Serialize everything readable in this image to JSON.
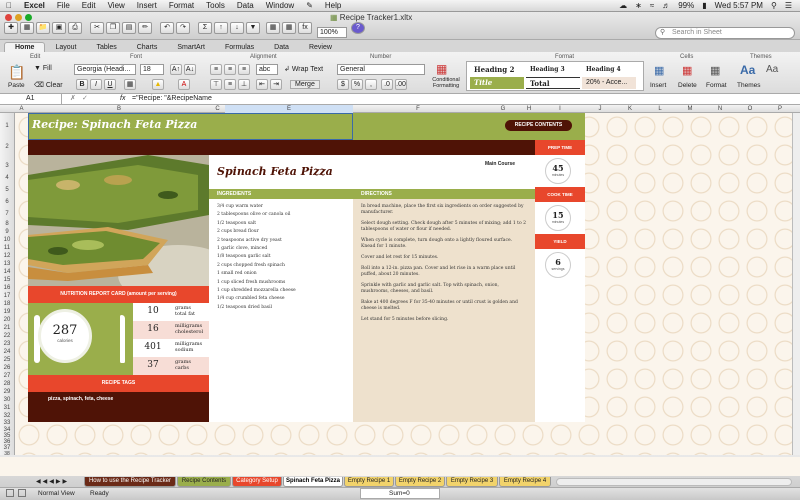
{
  "menubar": {
    "apple": "",
    "app": "Excel",
    "items": [
      "File",
      "Edit",
      "View",
      "Insert",
      "Format",
      "Tools",
      "Data",
      "Window",
      "Help"
    ],
    "battery": "99%",
    "clock": "Wed 5:57 PM"
  },
  "window": {
    "title": "Recipe Tracker1.xltx"
  },
  "toolbar": {
    "zoom": "100%",
    "search_placeholder": "Search in Sheet"
  },
  "ribbon_tabs": [
    "Home",
    "Layout",
    "Tables",
    "Charts",
    "SmartArt",
    "Formulas",
    "Data",
    "Review"
  ],
  "ribbon": {
    "groups": {
      "edit": "Edit",
      "font": "Font",
      "alignment": "Alignment",
      "number": "Number",
      "format": "Format",
      "cells": "Cells",
      "themes": "Themes"
    },
    "paste_label": "Paste",
    "fill_label": "Fill",
    "clear_label": "Clear",
    "font_name": "Georgia (Headi...",
    "font_size": "18",
    "wrap_text": "Wrap Text",
    "merge": "Merge",
    "number_format": "General",
    "abc": "abc",
    "conditional_formatting": "Conditional Formatting",
    "styles": [
      {
        "label": "Heading 2",
        "color": "#7d8f37"
      },
      {
        "label": "Heading 3",
        "color": "#4f1306"
      },
      {
        "label": "Heading 4",
        "color": "#4f1306"
      },
      {
        "label": "Title",
        "color": "#ffffff",
        "bg": "#9aae4b"
      },
      {
        "label": "Total",
        "color": "#222"
      },
      {
        "label": "20% - Acce...",
        "color": "#222"
      }
    ],
    "cells_buttons": [
      "Insert",
      "Delete",
      "Format"
    ],
    "themes_label": "Themes"
  },
  "formula_bar": {
    "cell_ref": "A1",
    "fx": "fx",
    "formula": "=\"Recipe: \"&RecipeName"
  },
  "columns": [
    "A",
    "B",
    "C",
    "D",
    "E",
    "F",
    "G",
    "H",
    "I",
    "J",
    "K",
    "L",
    "M",
    "N",
    "O",
    "P"
  ],
  "rows": [
    "1",
    "2",
    "3",
    "4",
    "5",
    "6",
    "7",
    "8",
    "9",
    "10",
    "11",
    "12",
    "13",
    "14",
    "15",
    "16",
    "17",
    "18",
    "19",
    "20",
    "21",
    "22",
    "23",
    "24",
    "25",
    "26",
    "27",
    "28",
    "29",
    "30",
    "31",
    "32",
    "33",
    "34",
    "35",
    "36",
    "37",
    "38",
    "39",
    "40",
    "41",
    "42",
    "43",
    "44",
    "45"
  ],
  "sheet": {
    "title": "Recipe: Spinach Feta Pizza",
    "recipe_contents_button": "RECIPE CONTENTS",
    "recipe_name": "Spinach Feta Pizza",
    "category": "Main Course",
    "ingredients_header": "INGREDIENTS",
    "directions_header": "DIRECTIONS",
    "ingredients": [
      "3/4 cup warm water",
      "2 tablespoons olive or canola oil",
      "1/2 teaspoon salt",
      "2 cups bread flour",
      "2 teaspoons active dry yeast",
      "1 garlic clove, minced",
      "1/8 teaspoon garlic salt",
      "2 cups chopped fresh spinach",
      "1 small red onion",
      "1 cup sliced fresh mushrooms",
      "1 cup shredded mozzarella cheese",
      "1/4 cup crumbled feta cheese",
      "1/2 teaspoon dried basil"
    ],
    "directions": [
      "In bread machine, place the first six ingredients on order suggested by manufacturer.",
      "Select dough setting.  Check dough after 5 minutes of mixing; add 1 to 2 tablespoons of water or flour if needed.",
      "When cycle is complete, turn dough onto a lightly floured surface. Knead for 1 minute.",
      "Cover and let rest for 15 minutes.",
      "Roll into a 12-in. pizza pan. Cover and let rise in a warm place until puffed, about 20 minutes.",
      "Sprinkle with garlic and garlic salt. Top with spinach, onion, mushrooms, cheeses, and basil.",
      "Bake at 400 degrees F for 35-40 minutes or until crust is golden and cheese is melted.",
      "Let stand for 5 minutes before slicing."
    ],
    "prep_time_label": "PREP TIME",
    "prep_time_value": "45",
    "prep_time_unit": "minutes",
    "cook_time_label": "COOK TIME",
    "cook_time_value": "15",
    "cook_time_unit": "minutes",
    "yield_label": "YIELD",
    "yield_value": "6",
    "yield_unit": "servings",
    "nutrition_header": "NUTRITION REPORT CARD (amount per serving)",
    "calories_value": "287",
    "calories_label": "calories",
    "nutrition": [
      {
        "value": "10",
        "unit": "grams",
        "name": "total fat",
        "bg": "#ffffff"
      },
      {
        "value": "16",
        "unit": "milligrams",
        "name": "cholesterol",
        "bg": "#f7ddd6"
      },
      {
        "value": "401",
        "unit": "milligrams",
        "name": "sodium",
        "bg": "#ffffff"
      },
      {
        "value": "37",
        "unit": "grams",
        "name": "carbs",
        "bg": "#f7ddd6"
      }
    ],
    "tags_header": "RECIPE TAGS",
    "tags": "pizza, spinach, feta, cheese"
  },
  "sheet_tabs": [
    {
      "label": "How to use the Recipe Tracker",
      "bg": "#6b2a17",
      "color": "#ffffff",
      "active": false
    },
    {
      "label": "Recipe Contents",
      "bg": "#9aae4b",
      "color": "#222222",
      "active": false
    },
    {
      "label": "Category Setup",
      "bg": "#e8472c",
      "color": "#ffffff",
      "active": false
    },
    {
      "label": "Spinach Feta Pizza",
      "bg": "#ffffff",
      "color": "#000000",
      "active": true
    },
    {
      "label": "Empty Recipe 1",
      "bg": "#f2d36b",
      "color": "#222222",
      "active": false
    },
    {
      "label": "Empty Recipe 2",
      "bg": "#f2d36b",
      "color": "#222222",
      "active": false
    },
    {
      "label": "Empty Recipe 3",
      "bg": "#f2d36b",
      "color": "#222222",
      "active": false
    },
    {
      "label": "Empty Recipe 4",
      "bg": "#f2d36b",
      "color": "#222222",
      "active": false
    }
  ],
  "status": {
    "view": "Normal View",
    "state": "Ready",
    "sum": "Sum=0"
  }
}
